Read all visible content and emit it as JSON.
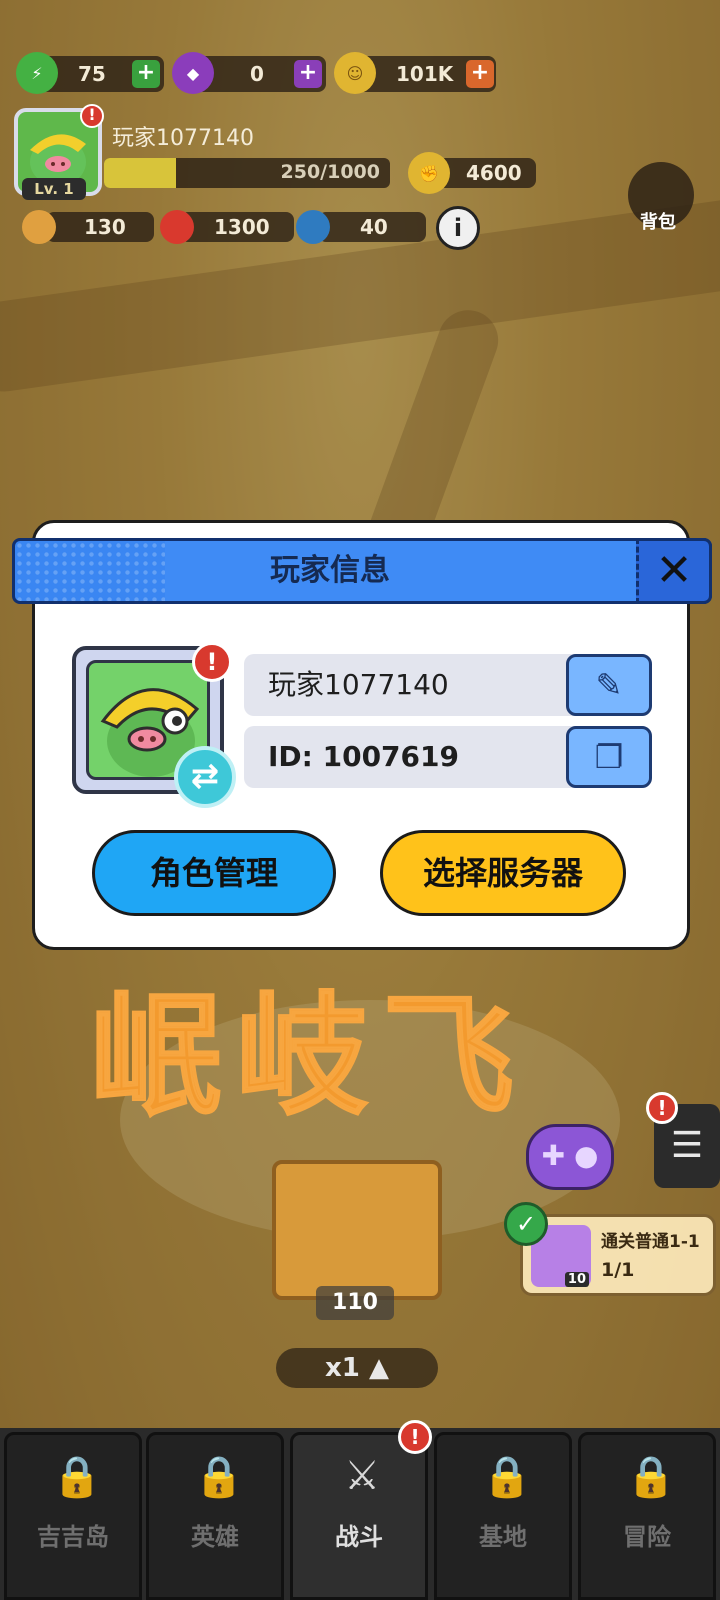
{
  "hud": {
    "energy": {
      "icon": "lightning-icon",
      "value": "75",
      "plus": "+",
      "color": "#4cc34a"
    },
    "gems": {
      "icon": "gem-icon",
      "value": "0",
      "plus": "+",
      "color": "#9a48c9"
    },
    "coins": {
      "icon": "coin-icon",
      "value": "101K",
      "plus": "+",
      "color": "#e0a72d"
    },
    "player_name": "玩家1077140",
    "level": "Lv. 1",
    "xp_text": "250/1000",
    "xp_fraction": 0.25,
    "power": "4600",
    "attack": "130",
    "hp": "1300",
    "defense": "40",
    "info_symbol": "i",
    "bag_label": "背包"
  },
  "modal": {
    "title": "玩家信息",
    "close_symbol": "✕",
    "player_name": "玩家1077140",
    "player_id": "ID: 1007619",
    "edit_icon": "edit-icon",
    "copy_icon": "copy-icon",
    "swap_symbol": "⇄",
    "alert_symbol": "!",
    "role_manage_label": "角色管理",
    "select_server_label": "选择服务器",
    "header_color": "#3a86f2",
    "role_btn_color": "#1fa6f5",
    "server_btn_color": "#ffc21a"
  },
  "watermark": "岷岐飞",
  "scene": {
    "crate_count": "110",
    "speed_label": "x1 ▲",
    "quest": {
      "title": "通关普通1-1",
      "progress": "1/1",
      "reward_count": "10"
    },
    "check_symbol": "✓",
    "menu_symbol": "☰",
    "gamepad_symbol": "✚ ●"
  },
  "nav": {
    "tabs": [
      {
        "label": "吉吉岛",
        "icon": "lock-icon"
      },
      {
        "label": "英雄",
        "icon": "lock-icon"
      },
      {
        "label": "战斗",
        "icon": "crossed-swords-icon"
      },
      {
        "label": "基地",
        "icon": "lock-icon"
      },
      {
        "label": "冒险",
        "icon": "lock-icon"
      }
    ],
    "lock_symbol": "🔒",
    "battle_symbol": "⚔"
  }
}
